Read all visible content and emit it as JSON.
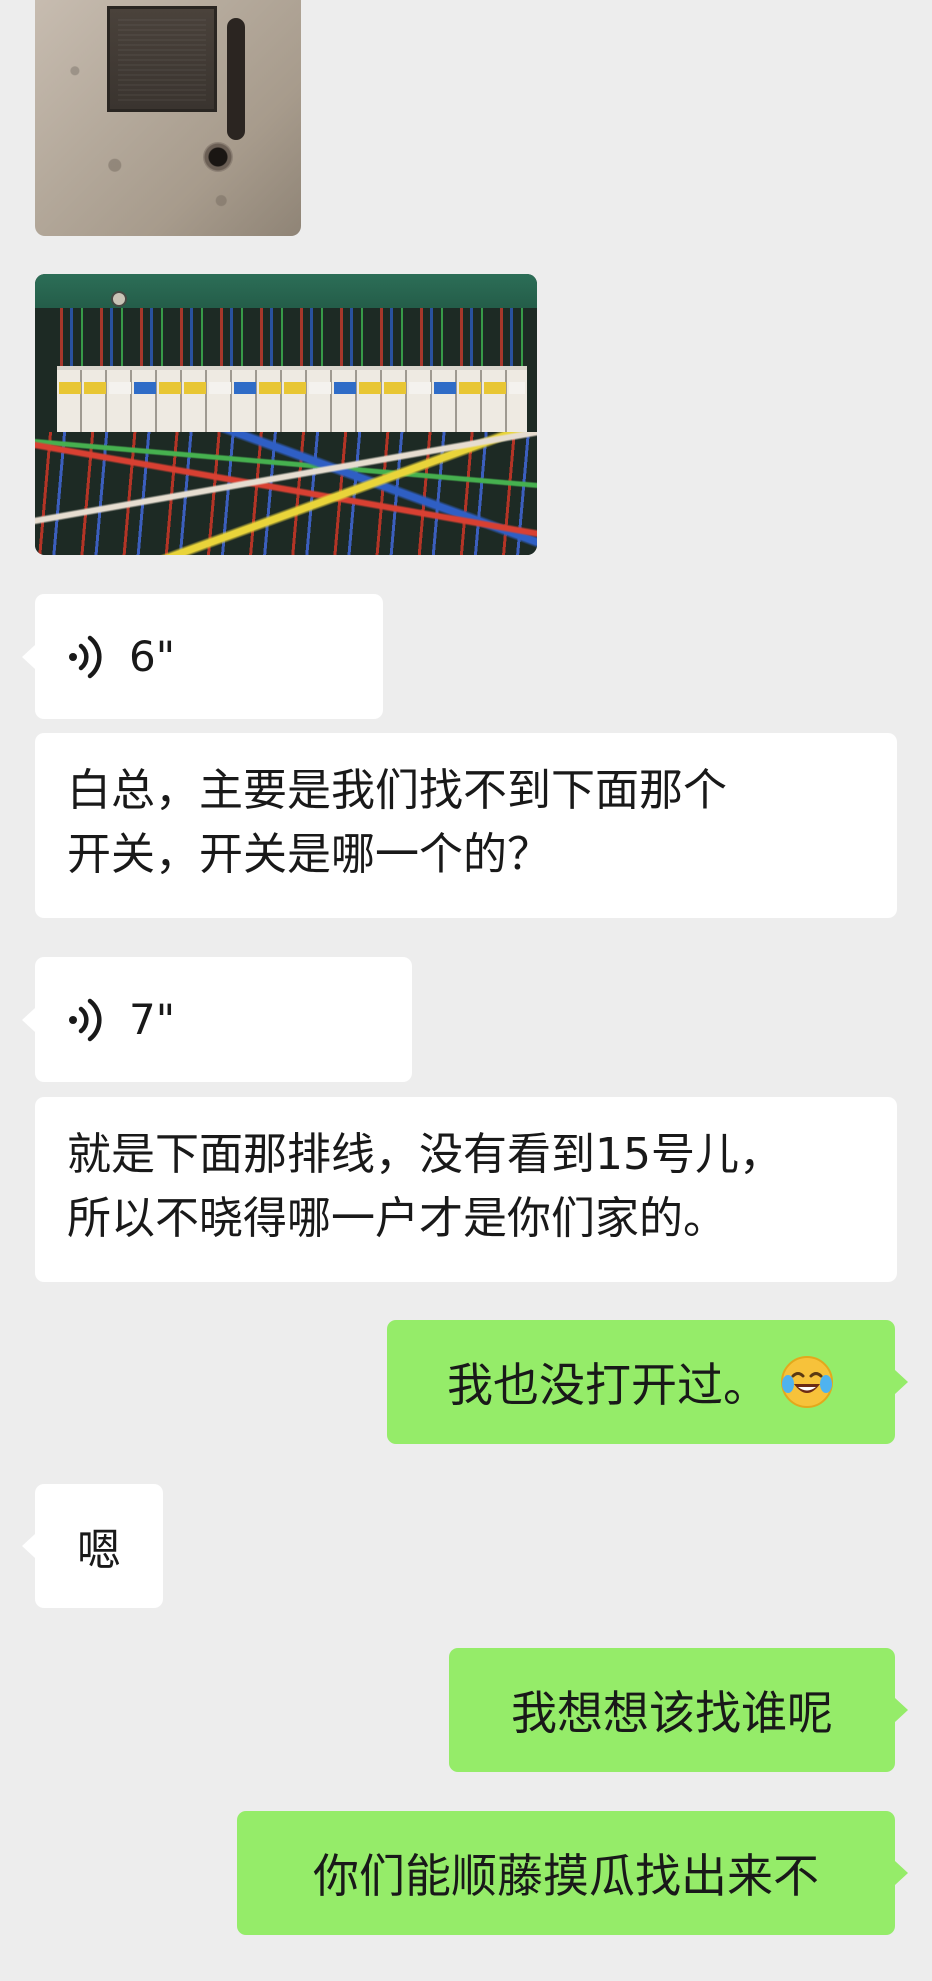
{
  "messages": {
    "voice1": {
      "duration": "6\""
    },
    "text1": {
      "line1": "白总，主要是我们找不到下面那个",
      "line2": "开关，开关是哪一个的？"
    },
    "voice2": {
      "duration": "7\""
    },
    "text2": {
      "line1": "就是下面那排线，没有看到15号儿，",
      "line2": "所以不晓得哪一户才是你们家的。"
    },
    "sent1": {
      "text": "我也没打开过。",
      "emoji": "crying-laughing-emoji"
    },
    "received1": {
      "text": "嗯"
    },
    "sent2": {
      "text": "我想想该找谁呢"
    },
    "sent3": {
      "text": "你们能顺藤摸瓜找出来不"
    }
  },
  "colors": {
    "background": "#ededed",
    "received_bubble": "#ffffff",
    "sent_bubble": "#95ec69",
    "text": "#191919"
  }
}
